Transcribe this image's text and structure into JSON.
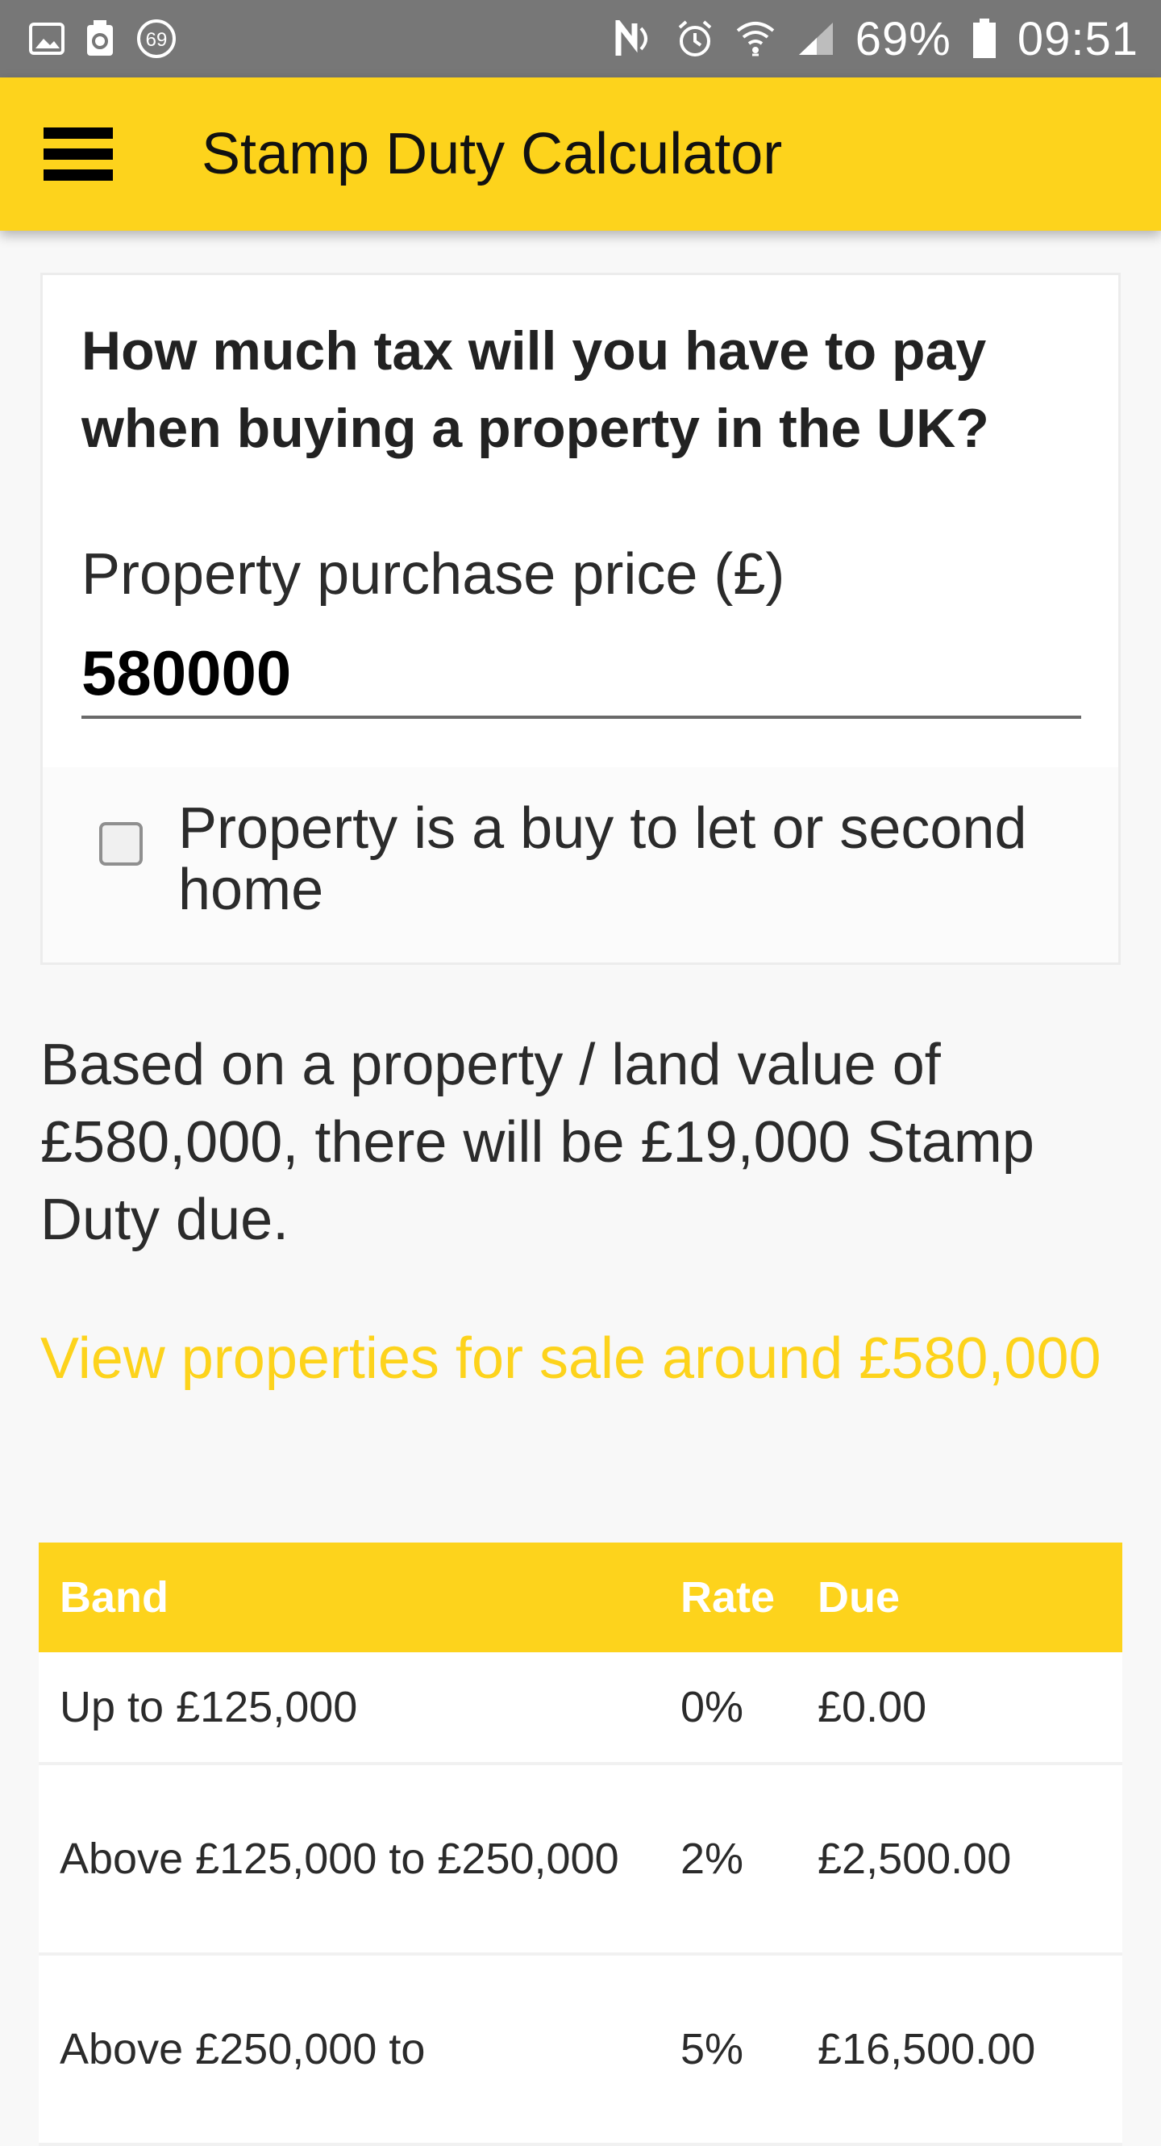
{
  "status_bar": {
    "battery": "69%",
    "time": "09:51",
    "badge": "69",
    "icons": [
      "image-icon",
      "recycle-icon",
      "badge-69-icon",
      "nfc-icon",
      "alarm-icon",
      "wifi-icon",
      "signal-icon",
      "battery-icon"
    ]
  },
  "appbar": {
    "title": "Stamp Duty Calculator",
    "menu_icon": "hamburger-menu-icon"
  },
  "form": {
    "heading": "How much tax will you have to pay when buying a property in the UK?",
    "price_label": "Property purchase price (£)",
    "price_value": "580000",
    "checkbox_label": "Property is a buy to let or second home",
    "checkbox_checked": false
  },
  "result": {
    "text": "Based on a property / land value of £580,000, there will be £19,000 Stamp Duty due."
  },
  "link": {
    "text": "View properties for sale around £580,000"
  },
  "table": {
    "headers": {
      "band": "Band",
      "rate": "Rate",
      "due": "Due"
    },
    "rows": [
      {
        "band": "Up to £125,000",
        "rate": "0%",
        "due": "£0.00"
      },
      {
        "band": "Above £125,000 to £250,000",
        "rate": "2%",
        "due": "£2,500.00"
      },
      {
        "band": "Above £250,000 to",
        "rate": "5%",
        "due": "£16,500.00"
      }
    ]
  },
  "colors": {
    "accent": "#fdd31c",
    "status_bar": "#777777",
    "background": "#f8f8f8"
  }
}
